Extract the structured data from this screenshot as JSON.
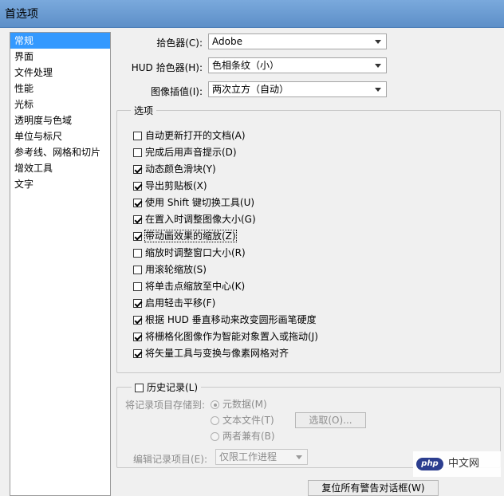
{
  "window": {
    "title": "首选项"
  },
  "sidebar": {
    "items": [
      {
        "label": "常规",
        "active": true
      },
      {
        "label": "界面"
      },
      {
        "label": "文件处理"
      },
      {
        "label": "性能"
      },
      {
        "label": "光标"
      },
      {
        "label": "透明度与色域"
      },
      {
        "label": "单位与标尺"
      },
      {
        "label": "参考线、网格和切片"
      },
      {
        "label": "增效工具"
      },
      {
        "label": "文字"
      }
    ]
  },
  "settings": {
    "color_picker": {
      "label": "拾色器(C):",
      "value": "Adobe"
    },
    "hud_picker": {
      "label": "HUD 拾色器(H):",
      "value": "色相条纹（小）"
    },
    "interpolation": {
      "label": "图像插值(I):",
      "value": "两次立方（自动）"
    }
  },
  "options": {
    "legend": "选项",
    "items": [
      {
        "label": "自动更新打开的文档(A)",
        "checked": false
      },
      {
        "label": "完成后用声音提示(D)",
        "checked": false
      },
      {
        "label": "动态颜色滑块(Y)",
        "checked": true
      },
      {
        "label": "导出剪贴板(X)",
        "checked": true
      },
      {
        "label": "使用 Shift 键切换工具(U)",
        "checked": true
      },
      {
        "label": "在置入时调整图像大小(G)",
        "checked": true
      },
      {
        "label": "带动画效果的缩放(Z)",
        "checked": true
      },
      {
        "label": "缩放时调整窗口大小(R)",
        "checked": false
      },
      {
        "label": "用滚轮缩放(S)",
        "checked": false
      },
      {
        "label": "将单击点缩放至中心(K)",
        "checked": false
      },
      {
        "label": "启用轻击平移(F)",
        "checked": true
      },
      {
        "label": "根据 HUD 垂直移动来改变圆形画笔硬度",
        "checked": true
      },
      {
        "label": "将栅格化图像作为智能对象置入或拖动(J)",
        "checked": true
      },
      {
        "label": "将矢量工具与变换与像素网格对齐",
        "checked": true
      }
    ]
  },
  "history": {
    "legend": "历史记录(L)",
    "checked": false,
    "save_to_label": "将记录项目存储到:",
    "radios": [
      {
        "label": "元数据(M)",
        "selected": true
      },
      {
        "label": "文本文件(T)",
        "selected": false
      },
      {
        "label": "两者兼有(B)",
        "selected": false
      }
    ],
    "choose_button": "选取(O)...",
    "edit_label": "编辑记录项目(E):",
    "edit_value": "仅限工作进程"
  },
  "footer": {
    "reset_button": "复位所有警告对话框(W)"
  },
  "watermark": {
    "logo_text": "php",
    "text": "中文网"
  }
}
